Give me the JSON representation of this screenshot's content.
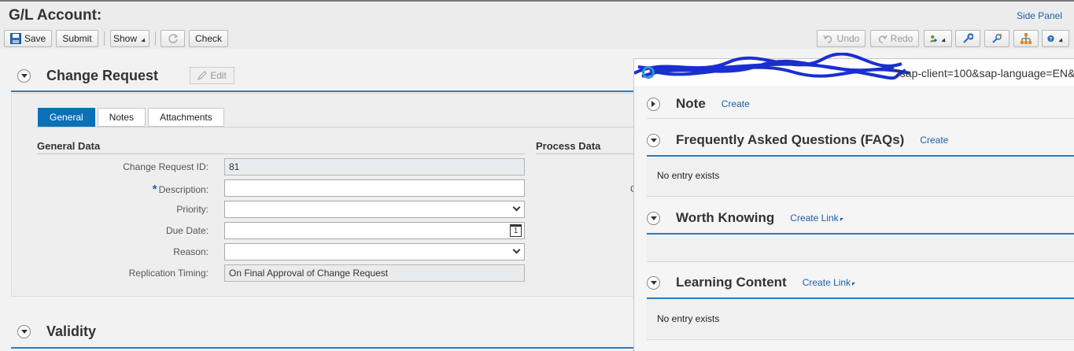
{
  "header": {
    "title": "G/L Account:",
    "side_panel": "Side Panel"
  },
  "toolbar": {
    "save": "Save",
    "submit": "Submit",
    "show": "Show",
    "check": "Check",
    "undo": "Undo",
    "redo": "Redo"
  },
  "change_request": {
    "title": "Change Request",
    "edit": "Edit",
    "tabs": [
      "General",
      "Notes",
      "Attachments"
    ],
    "general_data_title": "General Data",
    "process_data_title": "Process Data",
    "fields": {
      "id_label": "Change Request ID:",
      "id_value": "81",
      "description_label": "Description:",
      "description_value": "",
      "priority_label": "Priority:",
      "priority_value": "",
      "due_date_label": "Due Date:",
      "due_date_value": "",
      "reason_label": "Reason:",
      "reason_value": "",
      "timing_label": "Replication Timing:",
      "timing_value": "On Final Approval of Change Request"
    },
    "process_partial_label": "C"
  },
  "validity": {
    "title": "Validity"
  },
  "side_panel": {
    "url": "?sap-client=100&sap-language=EN&",
    "sections": {
      "note_title": "Note",
      "note_link": "Create",
      "faq_title": "Frequently Asked Questions (FAQs)",
      "faq_link": "Create",
      "faq_empty": "No entry exists",
      "worth_title": "Worth Knowing",
      "worth_link": "Create Link",
      "learning_title": "Learning Content",
      "learning_link": "Create Link",
      "learning_empty": "No entry exists"
    }
  },
  "colors": {
    "accent": "#0a70b8",
    "link": "#1a5fa8",
    "section_line": "#2f7bbd"
  }
}
